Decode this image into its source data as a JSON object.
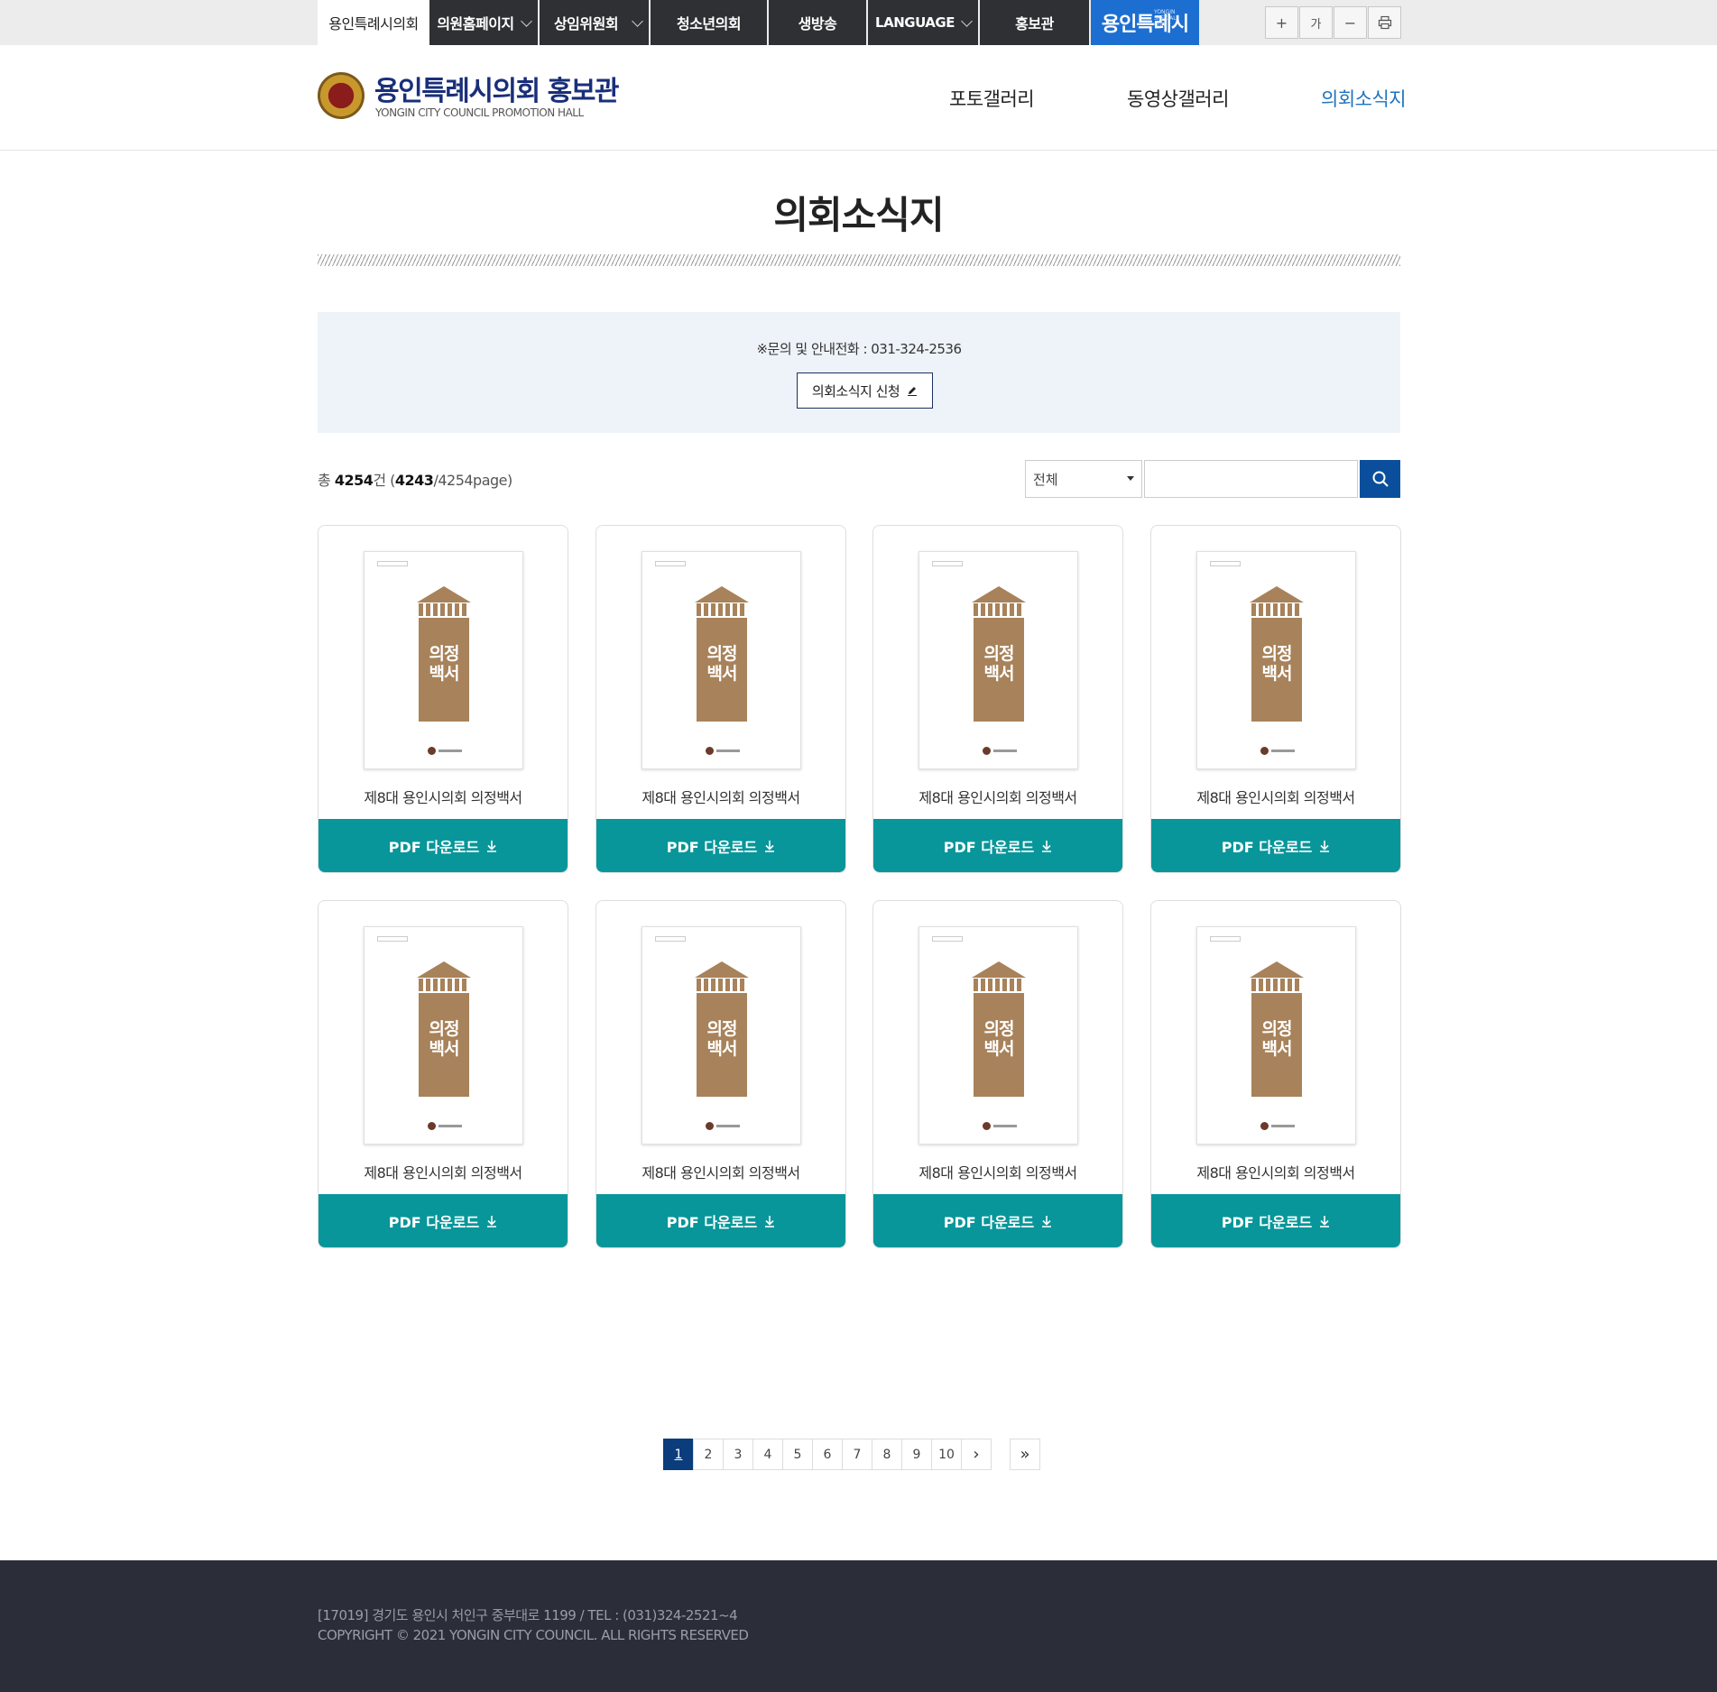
{
  "topnav": {
    "home": "용인특례시의회",
    "members": "의원홈페이지",
    "committee": "상임위원회",
    "youth": "청소년의회",
    "live": "생방송",
    "language": "LANGUAGE",
    "promo": "홍보관",
    "city": "용인특례시",
    "city_small": "YONGIN SPECIAL CITY",
    "tools": [
      "+",
      "가",
      "−",
      "⎙"
    ]
  },
  "header": {
    "title": "용인특례시의회 홍보관",
    "subtitle": "YONGIN CITY COUNCIL PROMOTION HALL",
    "nav": [
      "포토갤러리",
      "동영상갤러리",
      "의회소식지"
    ],
    "active_nav": "의회소식지"
  },
  "page": {
    "title": "의회소식지",
    "info": "※문의 및 안내전화 : 031-324-2536",
    "apply_label": "의회소식지 신청"
  },
  "list": {
    "count_prefix": "총 ",
    "total": "4254",
    "count_mid": "건 (",
    "current_page": "4243",
    "count_suffix": "/4254page)",
    "filter_selected": "전체",
    "search_value": ""
  },
  "cards": [
    {
      "title": "제8대 용인시의회 의정백서",
      "cover": "의정\n백서",
      "button": "PDF 다운로드"
    },
    {
      "title": "제8대 용인시의회 의정백서",
      "cover": "의정\n백서",
      "button": "PDF 다운로드"
    },
    {
      "title": "제8대 용인시의회 의정백서",
      "cover": "의정\n백서",
      "button": "PDF 다운로드"
    },
    {
      "title": "제8대 용인시의회 의정백서",
      "cover": "의정\n백서",
      "button": "PDF 다운로드"
    },
    {
      "title": "제8대 용인시의회 의정백서",
      "cover": "의정\n백서",
      "button": "PDF 다운로드"
    },
    {
      "title": "제8대 용인시의회 의정백서",
      "cover": "의정\n백서",
      "button": "PDF 다운로드"
    },
    {
      "title": "제8대 용인시의회 의정백서",
      "cover": "의정\n백서",
      "button": "PDF 다운로드"
    },
    {
      "title": "제8대 용인시의회 의정백서",
      "cover": "의정\n백서",
      "button": "PDF 다운로드"
    }
  ],
  "pagination": {
    "pages": [
      "1",
      "2",
      "3",
      "4",
      "5",
      "6",
      "7",
      "8",
      "9",
      "10"
    ],
    "current": "1",
    "next": "›",
    "last": "»"
  },
  "footer": {
    "address": "[17019] 경기도 용인시 처인구 중부대로 1199 / TEL : (031)324-2521~4",
    "copyright": "COPYRIGHT © 2021 YONGIN CITY COUNCIL. ALL RIGHTS RESERVED"
  },
  "colors": {
    "accent_blue": "#0b4f9c",
    "download_teal": "#08969a",
    "footer_bg": "#2b2d38",
    "topnav_dark": "#2f3033"
  }
}
